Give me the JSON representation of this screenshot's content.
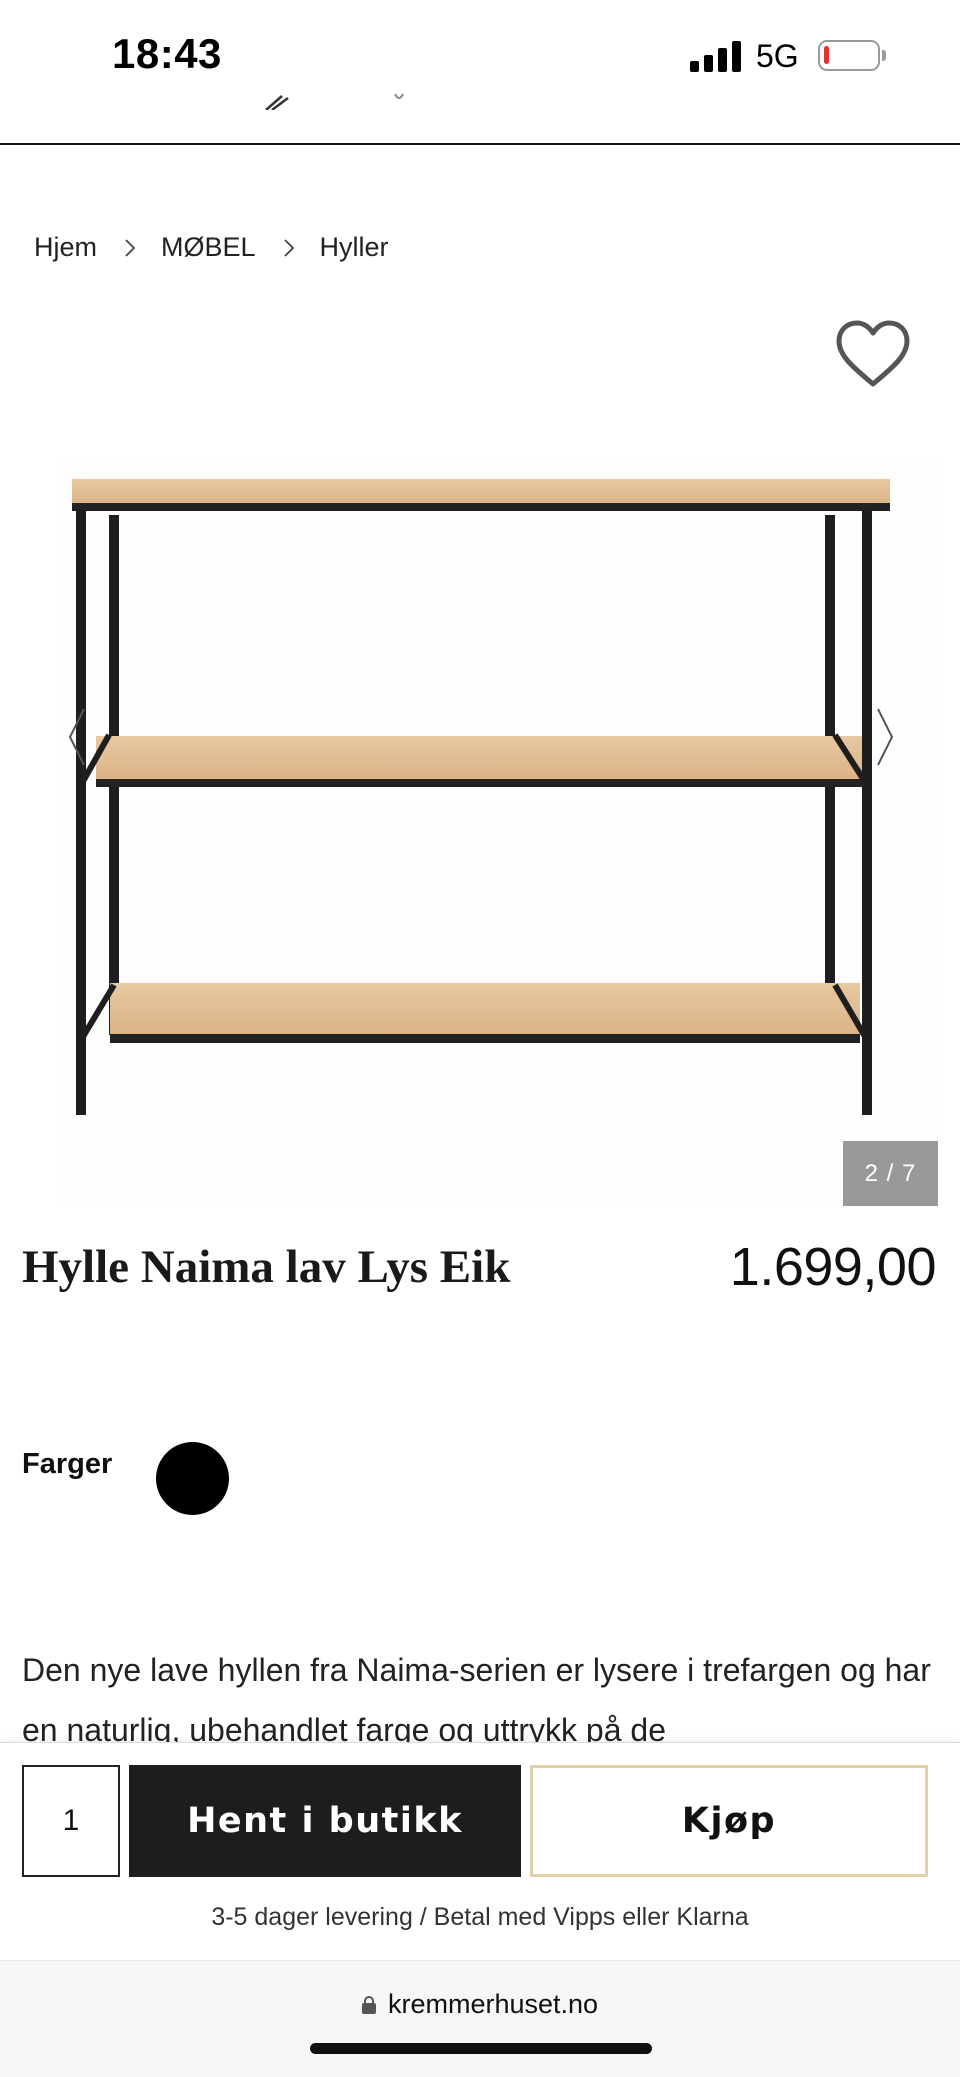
{
  "status_bar": {
    "time": "18:43",
    "network": "5G",
    "battery_level": 0.1
  },
  "breadcrumb": {
    "items": [
      "Hjem",
      "MØBEL",
      "Hyller"
    ]
  },
  "gallery": {
    "counter": "2 / 7"
  },
  "product": {
    "title": "Hylle Naima lav Lys Eik",
    "price": "1.699,00"
  },
  "colors": {
    "label": "Farger",
    "options": [
      {
        "color": "#000000"
      }
    ]
  },
  "description": {
    "text": "Den nye lave hyllen fra Naima-serien er lysere i trefargen og har en naturlig, ubehandlet farge og uttrykk på de"
  },
  "buy_bar": {
    "quantity": "1",
    "pickup_label": "Hent i butikk",
    "buy_label": "Kjøp",
    "delivery_note": "3-5 dager levering / Betal med Vipps eller Klarna"
  },
  "browser": {
    "url": "kremmerhuset.no"
  },
  "theme": {
    "buy_border": "#e2cfa8",
    "primary_dark": "#1d1d1d",
    "counter_bg": "#999999"
  }
}
